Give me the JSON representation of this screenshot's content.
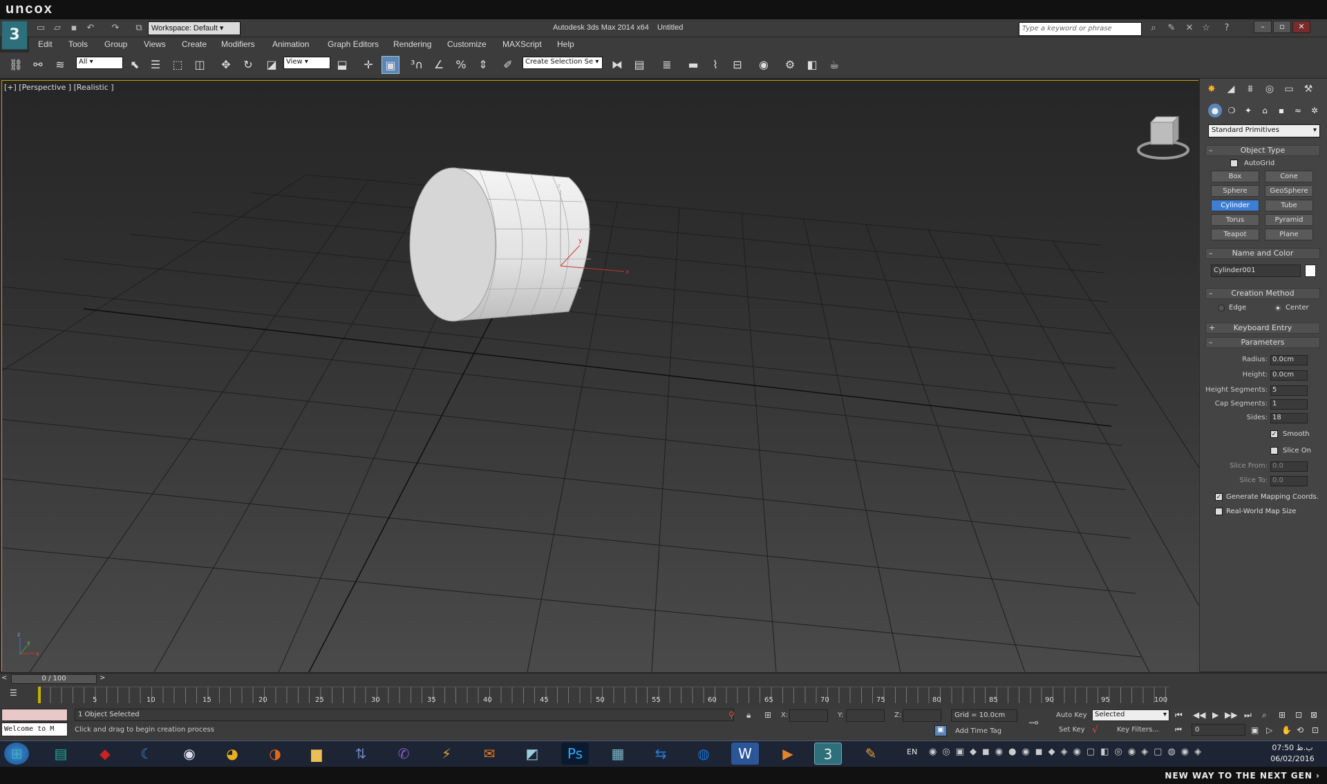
{
  "brand": "uncox",
  "app": {
    "title": "Autodesk 3ds Max  2014 x64",
    "document": "Untitled",
    "workspace": "Workspace: Default",
    "search_placeholder": "Type a keyword or phrase"
  },
  "menu": [
    "Edit",
    "Tools",
    "Group",
    "Views",
    "Create",
    "Modifiers",
    "Animation",
    "Graph Editors",
    "Rendering",
    "Customize",
    "MAXScript",
    "Help"
  ],
  "toolbar": {
    "filter": "All",
    "coord": "View",
    "selection_set": "Create Selection Se"
  },
  "viewport": {
    "label": "[+] [Perspective ] [Realistic ]",
    "axis_x": "x",
    "axis_y": "y",
    "axis_z": "z"
  },
  "command_panel": {
    "category": "Standard Primitives",
    "object_type": {
      "title": "Object Type",
      "autogrid": "AutoGrid",
      "buttons": [
        "Box",
        "Cone",
        "Sphere",
        "GeoSphere",
        "Cylinder",
        "Tube",
        "Torus",
        "Pyramid",
        "Teapot",
        "Plane"
      ],
      "active": "Cylinder"
    },
    "name_color": {
      "title": "Name and Color",
      "name": "Cylinder001",
      "color": "#ffffff"
    },
    "creation_method": {
      "title": "Creation Method",
      "edge": "Edge",
      "center": "Center",
      "selected": "Center"
    },
    "keyboard_entry": "Keyboard Entry",
    "parameters": {
      "title": "Parameters",
      "radius_label": "Radius:",
      "radius": "0.0cm",
      "height_label": "Height:",
      "height": "0.0cm",
      "hseg_label": "Height Segments:",
      "hseg": "5",
      "capseg_label": "Cap Segments:",
      "capseg": "1",
      "sides_label": "Sides:",
      "sides": "18",
      "smooth": "Smooth",
      "slice_on": "Slice On",
      "slice_from_label": "Slice From:",
      "slice_from": "0.0",
      "slice_to_label": "Slice To:",
      "slice_to": "0.0",
      "gen_map": "Generate Mapping Coords.",
      "real_world": "Real-World Map Size"
    }
  },
  "timeline": {
    "frame": "0 / 100",
    "ticks": [
      "5",
      "10",
      "15",
      "20",
      "25",
      "30",
      "35",
      "40",
      "45",
      "50",
      "55",
      "60",
      "65",
      "70",
      "75",
      "80",
      "85",
      "90",
      "95",
      "100"
    ]
  },
  "status": {
    "selected": "1 Object Selected",
    "prompt": "Click and drag to begin creation process",
    "welcome": "Welcome to M",
    "x_label": "X:",
    "y_label": "Y:",
    "z_label": "Z:",
    "grid": "Grid = 10.0cm",
    "add_time_tag": "Add Time Tag",
    "auto_key": "Auto Key",
    "set_key": "Set Key",
    "key_mode": "Selected",
    "key_filters": "Key Filters...",
    "frame_field": "0"
  },
  "taskbar": {
    "lang": "EN",
    "time": "07:50 ب.ظ",
    "date": "06/02/2016"
  },
  "footer": "NEW WAY TO THE NEXT GEN ›"
}
